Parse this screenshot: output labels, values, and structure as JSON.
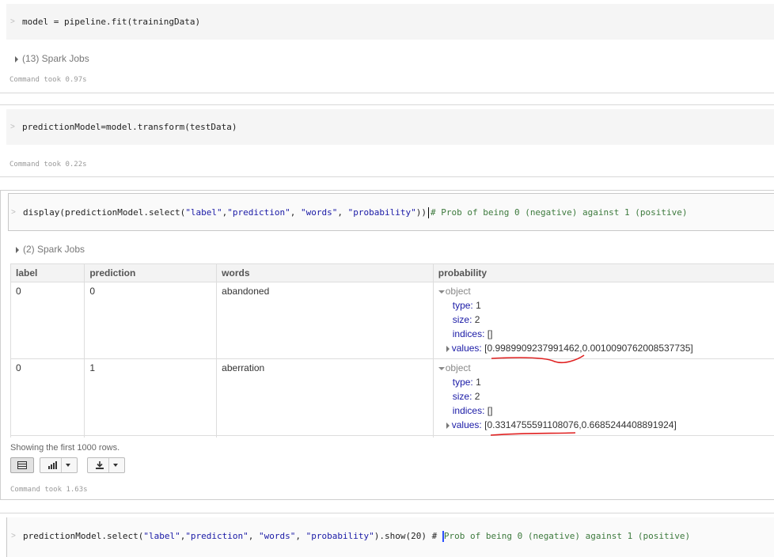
{
  "cells": [
    {
      "code": "model = pipeline.fit(trainingData)",
      "jobs": "(13) Spark Jobs",
      "took": "Command took 0.97s"
    },
    {
      "code": "predictionModel=model.transform(testData)",
      "took": "Command took 0.22s"
    },
    {
      "code_parts": {
        "fn": "display(predictionModel.select(",
        "s1": "\"label\"",
        "c1": ",",
        "s2": "\"prediction\"",
        "c2": ", ",
        "s3": "\"words\"",
        "c3": ", ",
        "s4": "\"probability\"",
        "end": "))",
        "comment": "# Prob of being 0 (negative) against 1 (positive)"
      },
      "jobs": "(2) Spark Jobs",
      "table": {
        "headers": [
          "label",
          "prediction",
          "words",
          "probability"
        ],
        "rows": [
          {
            "label": "0",
            "prediction": "0",
            "words": "abandoned",
            "obj_label": "object",
            "type_key": "type:",
            "type_val": "1",
            "size_key": "size:",
            "size_val": "2",
            "indices_key": "indices:",
            "indices_val": "[]",
            "values_key": "values:",
            "values_val": "[0.9989909237991462,0.0010090762008537735]"
          },
          {
            "label": "0",
            "prediction": "1",
            "words": "aberration",
            "obj_label": "object",
            "type_key": "type:",
            "type_val": "1",
            "size_key": "size:",
            "size_val": "2",
            "indices_key": "indices:",
            "indices_val": "[]",
            "values_key": "values:",
            "values_val": "[0.3314755591108076,0.6685244408891924]"
          }
        ]
      },
      "showing": "Showing the first 1000 rows.",
      "took": "Command took 1.63s"
    },
    {
      "code_parts": {
        "fn": "predictionModel.select(",
        "s1": "\"label\"",
        "c1": ",",
        "s2": "\"prediction\"",
        "c2": ", ",
        "s3": "\"words\"",
        "c3": ", ",
        "s4": "\"probability\"",
        "end": ").show(20) ",
        "comment_hash": "# ",
        "comment": "Prob of being 0 (negative) against 1 (positive)"
      }
    }
  ],
  "prompt_glyph": ">",
  "icons": {
    "table": "table-view-icon",
    "chart": "bar-chart-icon",
    "download": "download-icon",
    "dropdown": "chevron-down-icon",
    "expand": "triangle-right-icon",
    "collapse": "triangle-down-icon"
  },
  "colors": {
    "string": "#1a1aa6",
    "comment": "#3d7a3d",
    "annotation_underline": "#e02020"
  }
}
